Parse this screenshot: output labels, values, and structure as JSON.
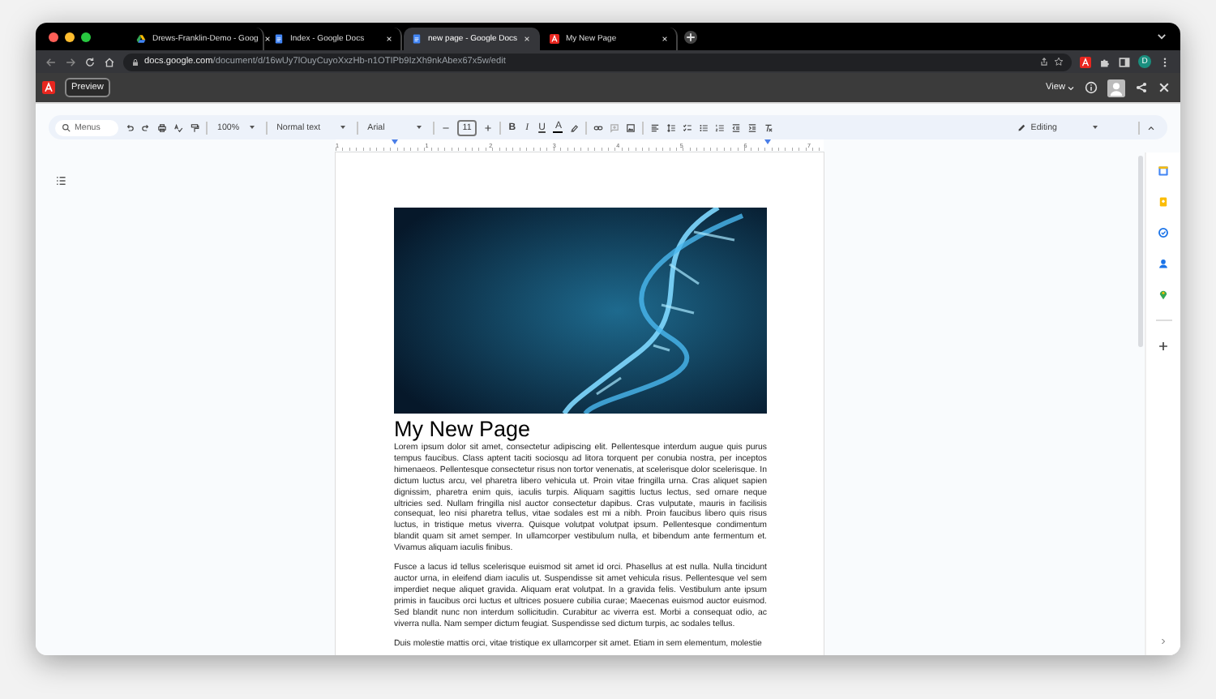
{
  "browser": {
    "tabs": [
      {
        "label": "Drews-Franklin-Demo - Goog",
        "selected": false,
        "kind": "drive"
      },
      {
        "label": "Index - Google Docs",
        "selected": false,
        "kind": "docs"
      },
      {
        "label": "new page - Google Docs",
        "selected": true,
        "kind": "docs"
      },
      {
        "label": "My New Page",
        "selected": false,
        "kind": "app"
      }
    ],
    "url_host": "docs.google.com",
    "url_path": "/document/d/16wUy7lOuyCuyoXxzHb-n1OTIPb9IzXh9nkAbex67x5w/edit",
    "profile_initial": "D"
  },
  "extension_bar": {
    "preview_button": "Preview",
    "view_menu": "View"
  },
  "toolbar": {
    "search_placeholder": "Menus",
    "zoom": "100%",
    "style": "Normal text",
    "font": "Arial",
    "font_size": "11",
    "bold": "B",
    "italic": "I",
    "underline": "U",
    "text_color": "A",
    "mode": "Editing"
  },
  "ruler": {
    "marks": [
      "1",
      "1",
      "2",
      "3",
      "4",
      "5",
      "6",
      "7"
    ]
  },
  "document": {
    "title": "My New Page",
    "paragraphs": [
      "Lorem ipsum dolor sit amet, consectetur adipiscing elit. Pellentesque interdum augue quis purus tempus faucibus. Class aptent taciti sociosqu ad litora torquent per conubia nostra, per inceptos himenaeos. Pellentesque consectetur risus non tortor venenatis, at scelerisque dolor scelerisque. In dictum luctus arcu, vel pharetra libero vehicula ut. Proin vitae fringilla urna. Cras aliquet sapien dignissim, pharetra enim quis, iaculis turpis. Aliquam sagittis luctus lectus, sed ornare neque ultricies sed. Nullam fringilla nisl auctor consectetur dapibus. Cras vulputate, mauris in facilisis consequat, leo nisi pharetra tellus, vitae sodales est mi a nibh. Proin faucibus libero quis risus luctus, in tristique metus viverra. Quisque volutpat volutpat ipsum. Pellentesque condimentum blandit quam sit amet semper. In ullamcorper vestibulum nulla, et bibendum ante fermentum et. Vivamus aliquam iaculis finibus.",
      "Fusce a lacus id tellus scelerisque euismod sit amet id orci. Phasellus at est nulla. Nulla tincidunt auctor urna, in eleifend diam iaculis ut. Suspendisse sit amet vehicula risus. Pellentesque vel sem imperdiet neque aliquet gravida. Aliquam erat volutpat. In a gravida felis. Vestibulum ante ipsum primis in faucibus orci luctus et ultrices posuere cubilia curae; Maecenas euismod auctor euismod. Sed blandit nunc non interdum sollicitudin. Curabitur ac viverra est. Morbi a consequat odio, ac viverra nulla. Nam semper dictum feugiat. Suspendisse sed dictum turpis, ac sodales tellus.",
      "Duis molestie mattis orci, vitae tristique ex ullamcorper sit amet. Etiam in sem elementum, molestie"
    ]
  }
}
